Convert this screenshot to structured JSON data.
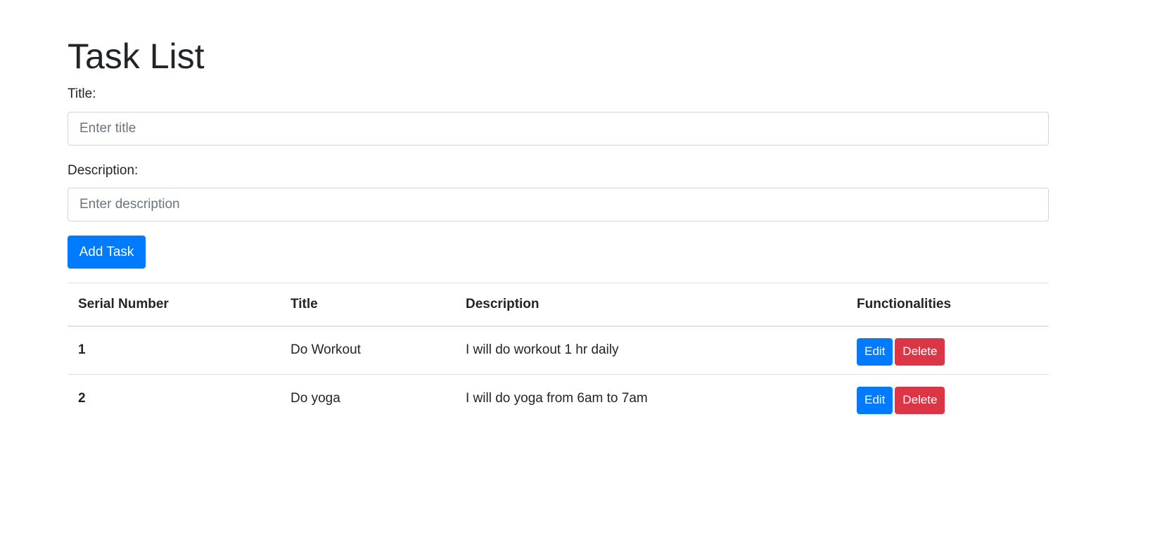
{
  "page": {
    "heading": "Task List"
  },
  "form": {
    "title_label": "Title:",
    "title_placeholder": "Enter title",
    "title_value": "",
    "description_label": "Description:",
    "description_placeholder": "Enter description",
    "description_value": "",
    "add_button_label": "Add Task"
  },
  "table": {
    "headers": [
      "Serial Number",
      "Title",
      "Description",
      "Functionalities"
    ],
    "rows": [
      {
        "serial": "1",
        "title": "Do Workout",
        "description": "I will do workout 1 hr daily",
        "edit_label": "Edit",
        "delete_label": "Delete"
      },
      {
        "serial": "2",
        "title": "Do yoga",
        "description": "I will do yoga from 6am to 7am",
        "edit_label": "Edit",
        "delete_label": "Delete"
      }
    ]
  },
  "colors": {
    "primary": "#007bff",
    "danger": "#dc3545",
    "text": "#212529",
    "border": "#dee2e6"
  }
}
